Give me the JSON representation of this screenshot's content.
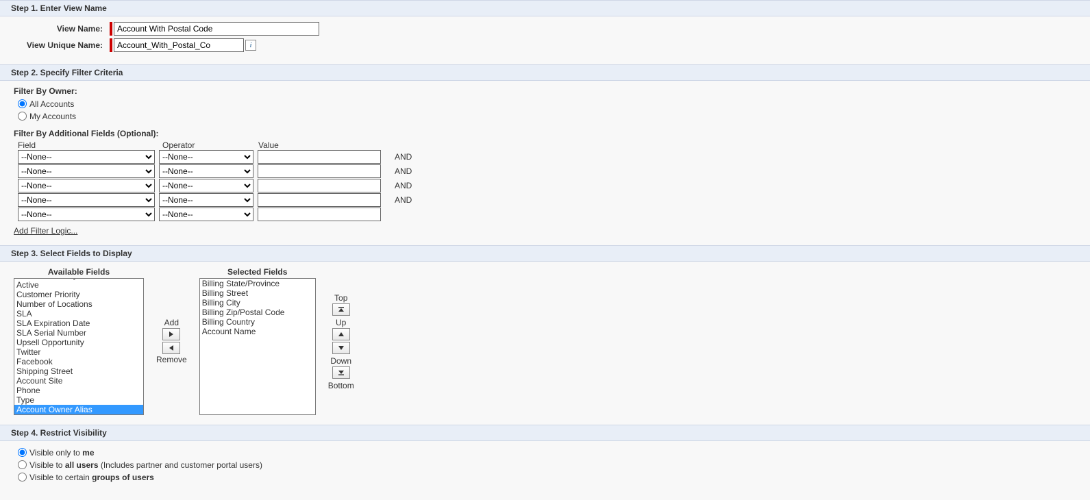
{
  "step1": {
    "title": "Step 1. Enter View Name",
    "labels": {
      "viewName": "View Name:",
      "viewUniqueName": "View Unique Name:"
    },
    "viewName": "Account With Postal Code",
    "viewUniqueName": "Account_With_Postal_Co",
    "infoGlyph": "i"
  },
  "step2": {
    "title": "Step 2. Specify Filter Criteria",
    "filterByOwnerLabel": "Filter By Owner:",
    "ownerOptions": {
      "all": "All Accounts",
      "my": "My Accounts"
    },
    "ownerSelected": "all",
    "filterByAdditionalLabel": "Filter By Additional Fields (Optional):",
    "columns": {
      "field": "Field",
      "operator": "Operator",
      "value": "Value"
    },
    "noneOption": "--None--",
    "rows": [
      {
        "field": "--None--",
        "operator": "--None--",
        "value": "",
        "and": "AND"
      },
      {
        "field": "--None--",
        "operator": "--None--",
        "value": "",
        "and": "AND"
      },
      {
        "field": "--None--",
        "operator": "--None--",
        "value": "",
        "and": "AND"
      },
      {
        "field": "--None--",
        "operator": "--None--",
        "value": "",
        "and": "AND"
      },
      {
        "field": "--None--",
        "operator": "--None--",
        "value": "",
        "and": ""
      }
    ],
    "addFilterLogic": "Add Filter Logic..."
  },
  "step3": {
    "title": "Step 3. Select Fields to Display",
    "availableHeader": "Available Fields",
    "selectedHeader": "Selected Fields",
    "available": [
      "Last Modified By Alias",
      "Active",
      "Customer Priority",
      "Number of Locations",
      "SLA",
      "SLA Expiration Date",
      "SLA Serial Number",
      "Upsell Opportunity",
      "Twitter",
      "Facebook",
      "Shipping Street",
      "Account Site",
      "Phone",
      "Type",
      "Account Owner Alias"
    ],
    "availableSelectedIndex": 14,
    "selected": [
      "Billing State/Province",
      "Billing Street",
      "Billing City",
      "Billing Zip/Postal Code",
      "Billing Country",
      "Account Name"
    ],
    "buttons": {
      "add": "Add",
      "remove": "Remove",
      "top": "Top",
      "up": "Up",
      "down": "Down",
      "bottom": "Bottom"
    }
  },
  "step4": {
    "title": "Step 4. Restrict Visibility",
    "options": {
      "me_pre": "Visible only to ",
      "me_bold": "me",
      "me_post": "",
      "all_pre": "Visible to ",
      "all_bold": "all users",
      "all_post": " (Includes partner and customer portal users)",
      "groups_pre": "Visible to certain ",
      "groups_bold": "groups of users",
      "groups_post": ""
    },
    "selected": "me"
  }
}
